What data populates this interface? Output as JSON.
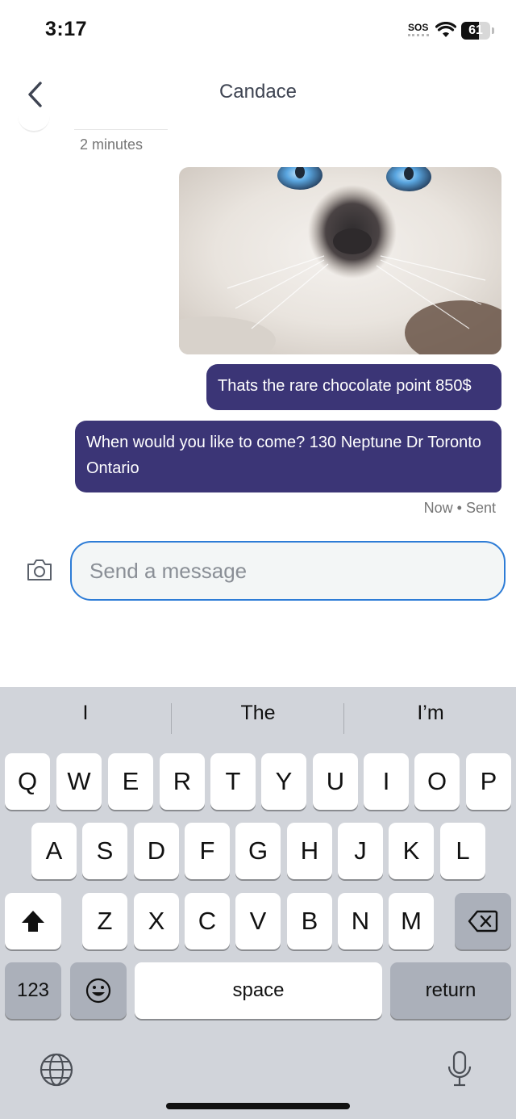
{
  "status_bar": {
    "time": "3:17",
    "sos": "SOS",
    "battery_level": "61",
    "battery_fraction": 0.61
  },
  "header": {
    "back_icon": "chevron-left-icon",
    "title": "Candace"
  },
  "messages": {
    "previous_timestamp": "2 minutes",
    "photo_icon": "kitten-photo",
    "bubble_1": "Thats the rare chocolate point 850$",
    "bubble_2": "When would you like to come? 130 Neptune Dr Toronto Ontario",
    "status": "Now • Sent"
  },
  "composer": {
    "camera_icon": "camera-icon",
    "placeholder": "Send a message",
    "value": ""
  },
  "keyboard": {
    "suggestions": [
      "I",
      "The",
      "I’m"
    ],
    "row1": [
      "Q",
      "W",
      "E",
      "R",
      "T",
      "Y",
      "U",
      "I",
      "O",
      "P"
    ],
    "row2": [
      "A",
      "S",
      "D",
      "F",
      "G",
      "H",
      "J",
      "K",
      "L"
    ],
    "row3": [
      "Z",
      "X",
      "C",
      "V",
      "B",
      "N",
      "M"
    ],
    "numbers_label": "123",
    "space_label": "space",
    "return_label": "return",
    "shift_icon": "shift-icon",
    "delete_icon": "backspace-icon",
    "emoji_icon": "emoji-icon",
    "globe_icon": "globe-icon",
    "mic_icon": "microphone-icon"
  },
  "colors": {
    "bubble": "#3b3576",
    "input_border": "#2d7cd6",
    "keyboard_bg": "#d1d4da"
  }
}
